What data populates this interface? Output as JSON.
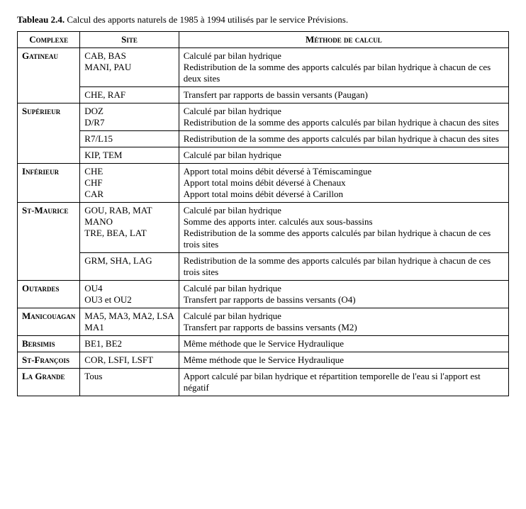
{
  "caption": {
    "prefix": "Tableau 2.4.",
    "text": " Calcul des apports naturels de 1985 à 1994 utilisés par le service Prévisions."
  },
  "table": {
    "headers": [
      "Complexe",
      "Site",
      "Méthode de calcul"
    ],
    "sections": [
      {
        "complexe": "Gatineau",
        "rows": [
          {
            "site": "CAB, BAS\nMANI, PAU",
            "methode": "Calculé par bilan hydrique\nRedistribution de la somme des apports calculés par bilan hydrique à chacun de ces deux sites"
          },
          {
            "site": "CHE, RAF",
            "methode": "Transfert par rapports de bassin versants (Paugan)"
          }
        ]
      },
      {
        "complexe": "Supérieur",
        "rows": [
          {
            "site": "DOZ\nD/R7",
            "methode": "Calculé par bilan hydrique\nRedistribution de la somme des apports calculés par bilan hydrique à chacun des sites"
          },
          {
            "site": "R7/L15",
            "methode": "Redistribution de la somme des apports calculés par bilan hydrique à chacun des sites"
          },
          {
            "site": "KIP, TEM",
            "methode": "Calculé par bilan hydrique"
          }
        ]
      },
      {
        "complexe": "Inférieur",
        "rows": [
          {
            "site": "CHE\nCHF\nCAR",
            "methode": "Apport total moins débit déversé à Témiscamingue\nApport total moins débit déversé à Chenaux\nApport total moins débit déversé à Carillon"
          }
        ]
      },
      {
        "complexe": "St-Maurice",
        "rows": [
          {
            "site": "GOU, RAB, MAT\nMANO\nTRE, BEA, LAT",
            "methode": "Calculé par bilan hydrique\nSomme des apports inter. calculés aux sous-bassins\nRedistribution de la somme des apports calculés par bilan hydrique à chacun de ces trois sites"
          },
          {
            "site": "GRM, SHA, LAG",
            "methode": "Redistribution de la somme des apports calculés par bilan hydrique à chacun de ces trois sites"
          }
        ]
      },
      {
        "complexe": "Outardes",
        "rows": [
          {
            "site": "OU4\nOU3 et OU2",
            "methode": "Calculé par bilan hydrique\nTransfert par rapports de bassins versants (O4)"
          }
        ]
      },
      {
        "complexe": "Manicouagan",
        "rows": [
          {
            "site": "MA5, MA3, MA2, LSA\nMA1",
            "methode": "Calculé par bilan hydrique\nTransfert par rapports de bassins versants (M2)"
          }
        ]
      },
      {
        "complexe": "Bersimis",
        "rows": [
          {
            "site": "BE1, BE2",
            "methode": "Même méthode que le Service Hydraulique"
          }
        ]
      },
      {
        "complexe": "St-François",
        "rows": [
          {
            "site": "COR, LSFI, LSFT",
            "methode": "Même méthode que le Service Hydraulique"
          }
        ]
      },
      {
        "complexe": "La Grande",
        "rows": [
          {
            "site": "Tous",
            "methode": "Apport calculé par bilan hydrique et répartition temporelle de l'eau si l'apport est négatif"
          }
        ]
      }
    ]
  }
}
